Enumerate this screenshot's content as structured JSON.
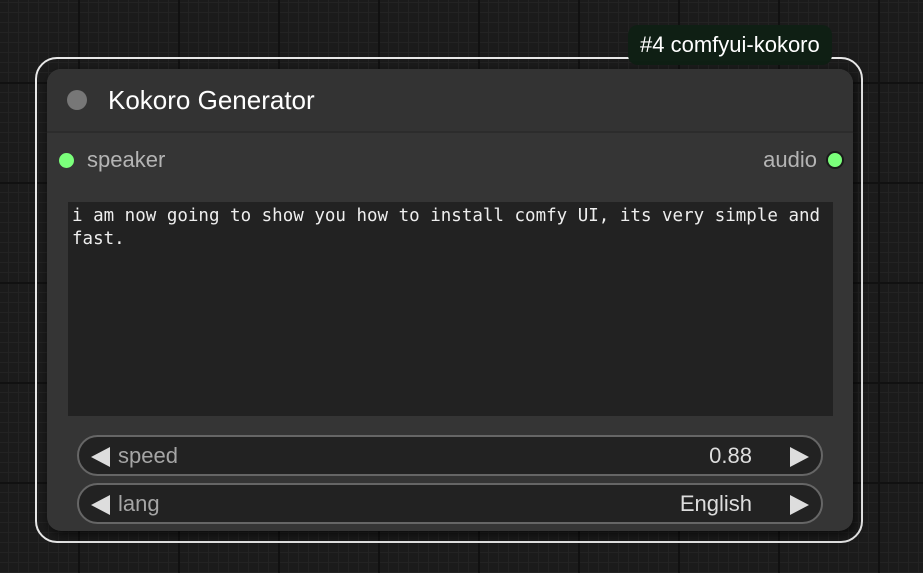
{
  "badge": {
    "label": "#4 comfyui-kokoro"
  },
  "node": {
    "title": "Kokoro Generator",
    "inputs": [
      {
        "label": "speaker",
        "color": "#7bff7b"
      }
    ],
    "outputs": [
      {
        "label": "audio",
        "color": "#7bff7b"
      }
    ],
    "text": "i am now going to show you how to install comfy UI, its very simple and fast.",
    "widgets": {
      "speed": {
        "label": "speed",
        "value": "0.88"
      },
      "lang": {
        "label": "lang",
        "value": "English"
      }
    }
  },
  "icons": {
    "collapse": "circle-dot-icon",
    "decrement": "triangle-left-icon",
    "increment": "triangle-right-icon"
  },
  "colors": {
    "slot": "#7bff7b",
    "badge_bg": "#0f1f14",
    "node_bg": "#353535",
    "canvas_bg": "#1b1b1b"
  }
}
